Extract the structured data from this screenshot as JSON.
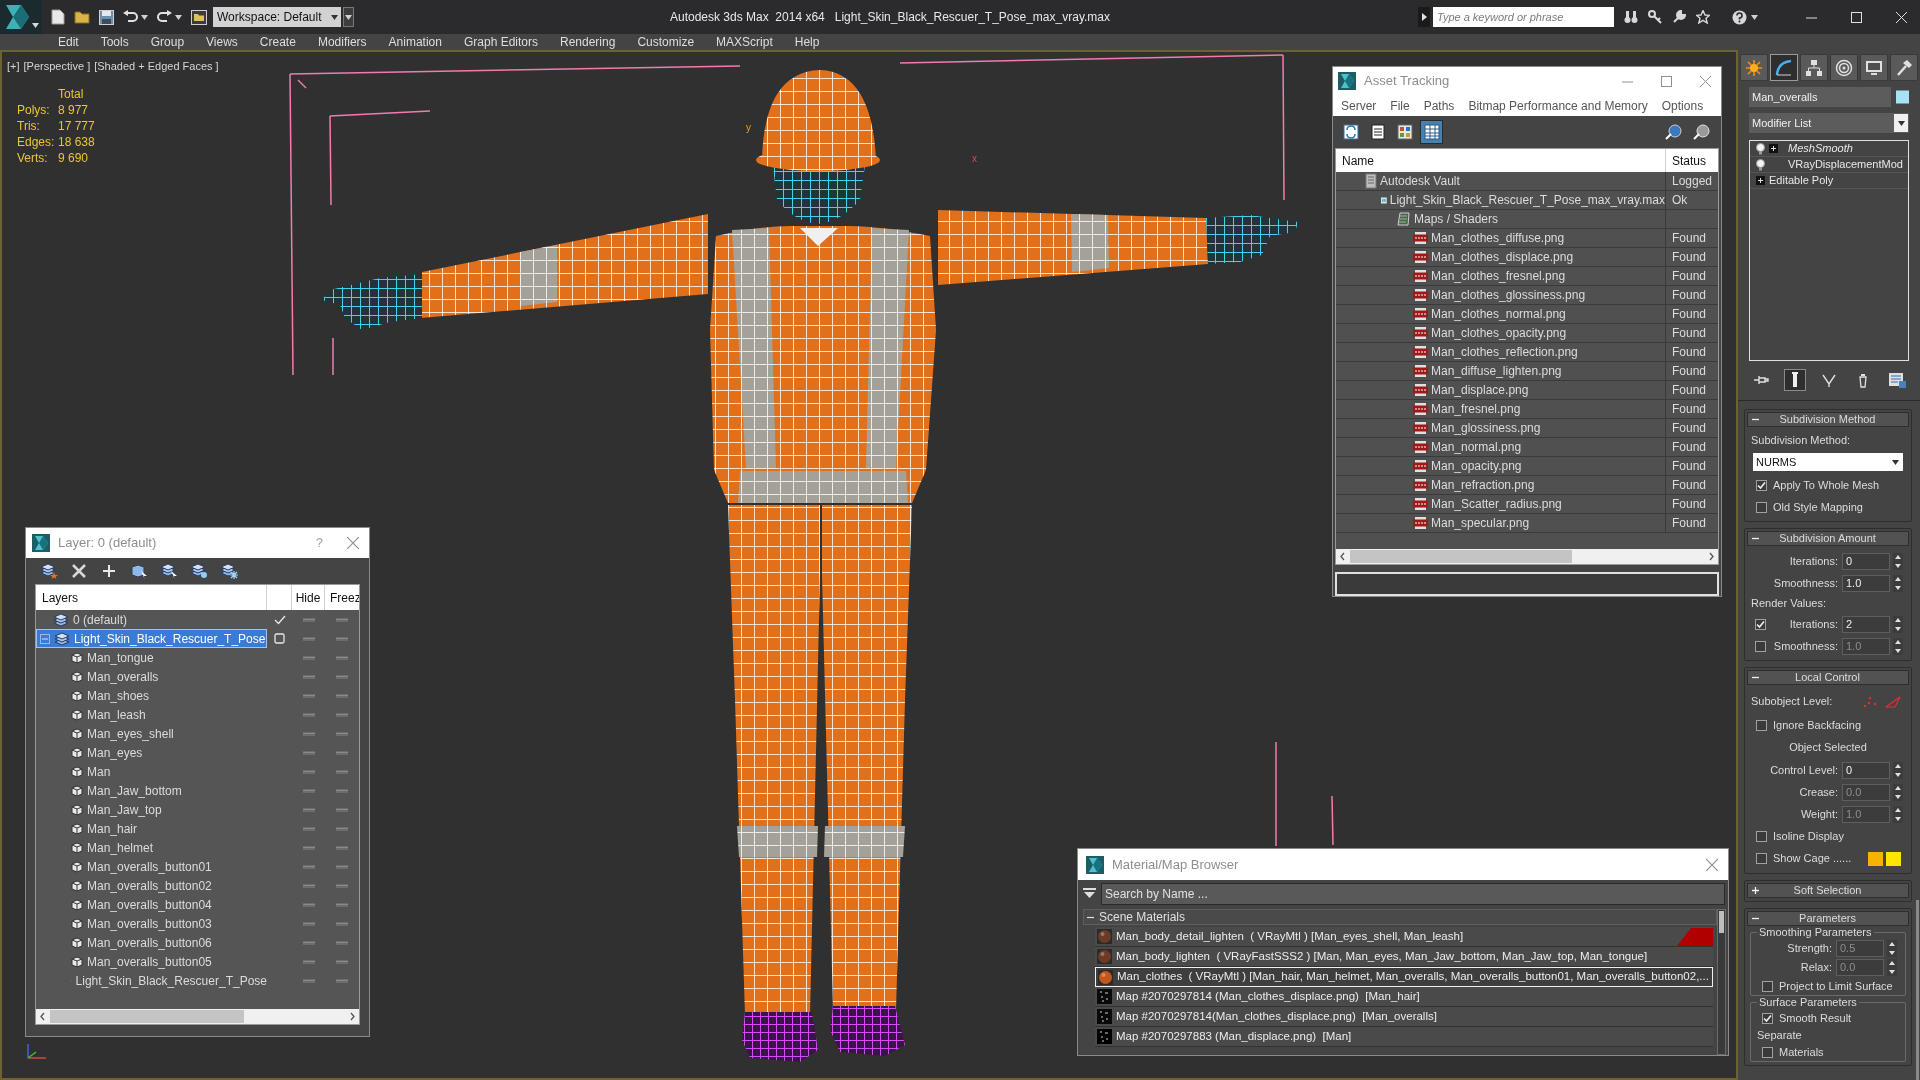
{
  "title_bar": {
    "workspace": "Workspace: Default",
    "app_title": "Autodesk 3ds Max  2014 x64",
    "file_name": "Light_Skin_Black_Rescuer_T_Pose_max_vray.max",
    "search": {
      "placeholder": "Type a keyword or phrase"
    }
  },
  "menu_bar": [
    "Edit",
    "Tools",
    "Group",
    "Views",
    "Create",
    "Modifiers",
    "Animation",
    "Graph Editors",
    "Rendering",
    "Customize",
    "MAXScript",
    "Help"
  ],
  "viewport": {
    "labels": [
      "[+]",
      "[Perspective ]",
      "[Shaded + Edged Faces ]"
    ],
    "stats": {
      "header": "Total",
      "rows": [
        {
          "label": "Polys:",
          "value": "8 977"
        },
        {
          "label": "Tris:",
          "value": "17 777"
        },
        {
          "label": "Edges:",
          "value": "18 638"
        },
        {
          "label": "Verts:",
          "value": "9 690"
        }
      ]
    },
    "axis_labels": [
      "y",
      "x"
    ]
  },
  "layer_window": {
    "title": "Layer: 0 (default)",
    "help": "?",
    "columns": [
      "Layers",
      "Hide",
      "Freez"
    ],
    "layers": [
      {
        "name": "0 (default)",
        "current": true,
        "selected": false,
        "hidden": false,
        "frozen": false
      },
      {
        "name": "Light_Skin_Black_Rescuer_T_Pose",
        "current": false,
        "selected": true,
        "hidden": false,
        "frozen": false,
        "expanded": true,
        "children": [
          {
            "name": "Man_tongue",
            "hidden": false,
            "frozen": false
          },
          {
            "name": "Man_overalls",
            "hidden": false,
            "frozen": false
          },
          {
            "name": "Man_shoes",
            "hidden": false,
            "frozen": false
          },
          {
            "name": "Man_leash",
            "hidden": false,
            "frozen": false
          },
          {
            "name": "Man_eyes_shell",
            "hidden": false,
            "frozen": false
          },
          {
            "name": "Man_eyes",
            "hidden": false,
            "frozen": false
          },
          {
            "name": "Man",
            "hidden": false,
            "frozen": false
          },
          {
            "name": "Man_Jaw_bottom",
            "hidden": false,
            "frozen": false
          },
          {
            "name": "Man_Jaw_top",
            "hidden": false,
            "frozen": false
          },
          {
            "name": "Man_hair",
            "hidden": false,
            "frozen": false
          },
          {
            "name": "Man_helmet",
            "hidden": false,
            "frozen": false
          },
          {
            "name": "Man_overalls_button01",
            "hidden": false,
            "frozen": false
          },
          {
            "name": "Man_overalls_button02",
            "hidden": false,
            "frozen": false
          },
          {
            "name": "Man_overalls_button04",
            "hidden": false,
            "frozen": false
          },
          {
            "name": "Man_overalls_button03",
            "hidden": false,
            "frozen": false
          },
          {
            "name": "Man_overalls_button06",
            "hidden": false,
            "frozen": false
          },
          {
            "name": "Man_overalls_button05",
            "hidden": false,
            "frozen": false
          },
          {
            "name": "Light_Skin_Black_Rescuer_T_Pose",
            "hidden": false,
            "frozen": false
          }
        ]
      }
    ]
  },
  "asset_tracking": {
    "title": "Asset Tracking",
    "menu": [
      "Server",
      "File",
      "Paths",
      "Bitmap Performance and Memory",
      "Options"
    ],
    "toolbar": [
      {
        "kind": "refresh",
        "selected": false
      },
      {
        "kind": "list",
        "selected": false
      },
      {
        "kind": "thumbnails",
        "selected": false
      },
      {
        "kind": "table",
        "selected": true
      }
    ],
    "columns": [
      "Name",
      "Status"
    ],
    "tree": [
      {
        "kind": "vault",
        "name": "Autodesk Vault",
        "status": "Logged",
        "children": [
          {
            "kind": "scene",
            "name": "Light_Skin_Black_Rescuer_T_Pose_max_vray.max",
            "status": "Ok",
            "children": [
              {
                "kind": "folder",
                "name": "Maps / Shaders",
                "children": [
                  {
                    "kind": "png",
                    "name": "Man_clothes_diffuse.png",
                    "status": "Found"
                  },
                  {
                    "kind": "png",
                    "name": "Man_clothes_displace.png",
                    "status": "Found"
                  },
                  {
                    "kind": "png",
                    "name": "Man_clothes_fresnel.png",
                    "status": "Found"
                  },
                  {
                    "kind": "png",
                    "name": "Man_clothes_glossiness.png",
                    "status": "Found"
                  },
                  {
                    "kind": "png",
                    "name": "Man_clothes_normal.png",
                    "status": "Found"
                  },
                  {
                    "kind": "png",
                    "name": "Man_clothes_opacity.png",
                    "status": "Found"
                  },
                  {
                    "kind": "png",
                    "name": "Man_clothes_reflection.png",
                    "status": "Found"
                  },
                  {
                    "kind": "png",
                    "name": "Man_diffuse_lighten.png",
                    "status": "Found"
                  },
                  {
                    "kind": "png",
                    "name": "Man_displace.png",
                    "status": "Found"
                  },
                  {
                    "kind": "png",
                    "name": "Man_fresnel.png",
                    "status": "Found"
                  },
                  {
                    "kind": "png",
                    "name": "Man_glossiness.png",
                    "status": "Found"
                  },
                  {
                    "kind": "png",
                    "name": "Man_normal.png",
                    "status": "Found"
                  },
                  {
                    "kind": "png",
                    "name": "Man_opacity.png",
                    "status": "Found"
                  },
                  {
                    "kind": "png",
                    "name": "Man_refraction.png",
                    "status": "Found"
                  },
                  {
                    "kind": "png",
                    "name": "Man_Scatter_radius.png",
                    "status": "Found"
                  },
                  {
                    "kind": "png",
                    "name": "Man_specular.png",
                    "status": "Found"
                  }
                ]
              }
            ]
          }
        ]
      }
    ]
  },
  "material_browser": {
    "title": "Material/Map Browser",
    "search": {
      "placeholder": "Search by Name ..."
    },
    "group": {
      "title": "Scene Materials",
      "expanded": true,
      "items": [
        {
          "kind": "material",
          "color": "#6b3b28",
          "text": "Man_body_detail_lighten  ( VRayMtl ) [Man_eyes_shell, Man_leash]",
          "selected": false,
          "flagged": true
        },
        {
          "kind": "material",
          "color": "#6e3a26",
          "text": "Man_body_lighten  ( VRayFastSSS2 ) [Man, Man_eyes, Man_Jaw_bottom, Man_Jaw_top, Man_tongue]",
          "selected": false,
          "flagged": false
        },
        {
          "kind": "material",
          "color": "#c4561c",
          "text": "Man_clothes  ( VRayMtl ) [Man_hair, Man_helmet, Man_overalls, Man_overalls_button01, Man_overalls_button02,...",
          "selected": true,
          "flagged": false
        },
        {
          "kind": "map",
          "color": "#0a0a0a",
          "text": "Map #2070297814 (Man_clothes_displace.png)  [Man_hair]",
          "selected": false,
          "flagged": false
        },
        {
          "kind": "map",
          "color": "#0a0a0a",
          "text": "Map #2070297814(Man_clothes_displace.png)  [Man_overalls]",
          "selected": false,
          "flagged": false
        },
        {
          "kind": "map",
          "color": "#000000",
          "text": "Map #2070297883 (Man_displace.png)  [Man]",
          "selected": false,
          "flagged": false
        }
      ]
    }
  },
  "command_panel": {
    "tabs": [
      {
        "kind": "create",
        "selected": false
      },
      {
        "kind": "modify",
        "selected": true
      },
      {
        "kind": "hierarchy",
        "selected": false
      },
      {
        "kind": "motion",
        "selected": false
      },
      {
        "kind": "display",
        "selected": false
      },
      {
        "kind": "utilities",
        "selected": false
      }
    ],
    "object_name": "Man_overalls",
    "modifier_list": "Modifier List",
    "stack": [
      {
        "kind": "modifier",
        "name": "MeshSmooth",
        "enabled": true,
        "instanced": true,
        "expandable": true
      },
      {
        "kind": "modifier",
        "name": "VRayDisplacementMod",
        "enabled": true,
        "instanced": false,
        "expandable": false
      },
      {
        "kind": "base",
        "name": "Editable Poly",
        "expandable": true
      }
    ],
    "stack_tools": [
      {
        "kind": "pin",
        "on": false
      },
      {
        "kind": "end_result",
        "on": true
      },
      {
        "kind": "make_unique",
        "on": false
      },
      {
        "kind": "remove",
        "on": false
      },
      {
        "kind": "configure",
        "on": false
      }
    ],
    "rollouts": [
      {
        "title": "Subdivision Method",
        "expanded": true,
        "controls": [
          {
            "kind": "label",
            "text": "Subdivision Method:"
          },
          {
            "kind": "dropdown",
            "value": "NURMS"
          },
          {
            "kind": "checkbox",
            "label": "Apply To Whole Mesh",
            "checked": true
          },
          {
            "kind": "checkbox",
            "label": "Old Style Mapping",
            "checked": false
          }
        ]
      },
      {
        "title": "Subdivision Amount",
        "expanded": true,
        "controls": [
          {
            "kind": "spinner",
            "label": "Iterations:",
            "value": "0",
            "disabled": false
          },
          {
            "kind": "spinner",
            "label": "Smoothness:",
            "value": "1.0",
            "disabled": false
          },
          {
            "kind": "label",
            "text": "Render Values:"
          },
          {
            "kind": "check_spinner",
            "label": "Iterations:",
            "value": "2",
            "checked": true,
            "disabled": false
          },
          {
            "kind": "check_spinner",
            "label": "Smoothness:",
            "value": "1.0",
            "checked": false,
            "disabled": true
          }
        ]
      },
      {
        "title": "Local Control",
        "expanded": true,
        "controls": [
          {
            "kind": "subobject",
            "label": "Subobject Level:"
          },
          {
            "kind": "checkbox",
            "label": "Ignore Backfacing",
            "checked": false
          },
          {
            "kind": "note",
            "text": "Object Selected"
          },
          {
            "kind": "spinner",
            "label": "Control Level:",
            "value": "0",
            "disabled": false
          },
          {
            "kind": "spinner",
            "label": "Crease:",
            "value": "0.0",
            "disabled": true
          },
          {
            "kind": "spinner",
            "label": "Weight:",
            "value": "1.0",
            "disabled": true
          },
          {
            "kind": "checkbox",
            "label": "Isoline Display",
            "checked": false
          },
          {
            "kind": "cage",
            "label": "Show Cage ......",
            "checked": false
          }
        ]
      },
      {
        "title": "Soft Selection",
        "expanded": false
      },
      {
        "title": "Parameters",
        "expanded": true,
        "groups": [
          {
            "title": "Smoothing Parameters",
            "controls": [
              {
                "kind": "spinner",
                "label": "Strength:",
                "value": "0.5",
                "disabled": true
              },
              {
                "kind": "spinner",
                "label": "Relax:",
                "value": "0.0",
                "disabled": true
              },
              {
                "kind": "checkbox",
                "label": "Project to Limit Surface",
                "checked": false
              }
            ]
          },
          {
            "title": "Surface Parameters",
            "controls": [
              {
                "kind": "checkbox",
                "label": "Smooth Result",
                "checked": true
              },
              {
                "kind": "label",
                "text": "Separate"
              },
              {
                "kind": "checkbox",
                "label": "Materials",
                "checked": false
              }
            ]
          }
        ]
      }
    ]
  }
}
